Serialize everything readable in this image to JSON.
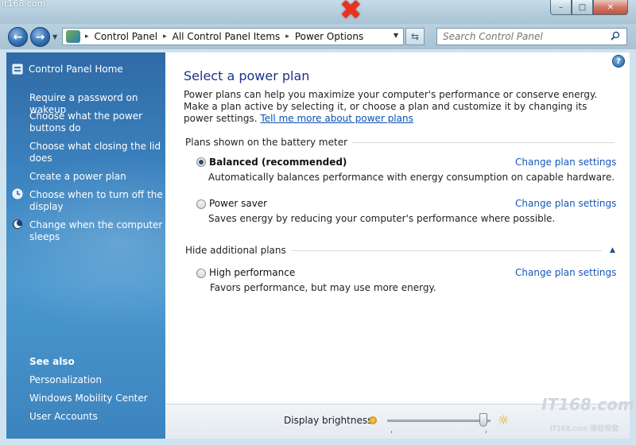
{
  "watermark": {
    "top_text": "it168.com",
    "logo_text": "IT168.com",
    "sub_text": "IT168.com 微软视窗"
  },
  "window": {
    "minimize": "–",
    "maximize": "□",
    "close": "✕"
  },
  "nav": {
    "back_glyph": "←",
    "forward_glyph": "→",
    "history_glyph": "▼",
    "breadcrumb": [
      "Control Panel",
      "All Control Panel Items",
      "Power Options"
    ],
    "separator": "▸",
    "dropdown_glyph": "▼",
    "refresh_glyph": "⇆",
    "search_placeholder": "Search Control Panel"
  },
  "sidebar": {
    "home": "Control Panel Home",
    "links": [
      "Require a password on wakeup",
      "Choose what the power buttons do",
      "Choose what closing the lid does",
      "Create a power plan",
      "Choose when to turn off the display",
      "Change when the computer sleeps"
    ],
    "see_also_heading": "See also",
    "see_also": [
      "Personalization",
      "Windows Mobility Center",
      "User Accounts"
    ]
  },
  "main": {
    "help_glyph": "?",
    "title": "Select a power plan",
    "intro": "Power plans can help you maximize your computer's performance or conserve energy. Make a plan active by selecting it, or choose a plan and customize it by changing its power settings.",
    "intro_link": "Tell me more about power plans",
    "group_battery": "Plans shown on the battery meter",
    "group_additional": "Hide additional plans",
    "collapse_glyph": "▲",
    "change_settings": "Change plan settings",
    "plans": [
      {
        "name": "Balanced (recommended)",
        "desc": "Automatically balances performance with energy consumption on capable hardware.",
        "selected": true
      },
      {
        "name": "Power saver",
        "desc": "Saves energy by reducing your computer's performance where possible.",
        "selected": false
      },
      {
        "name": "High performance",
        "desc": "Favors performance, but may use more energy.",
        "selected": false
      }
    ]
  },
  "bottom": {
    "brightness_label": "Display brightness:",
    "brightness_level": 0.97,
    "sun_glyph": "☼"
  }
}
